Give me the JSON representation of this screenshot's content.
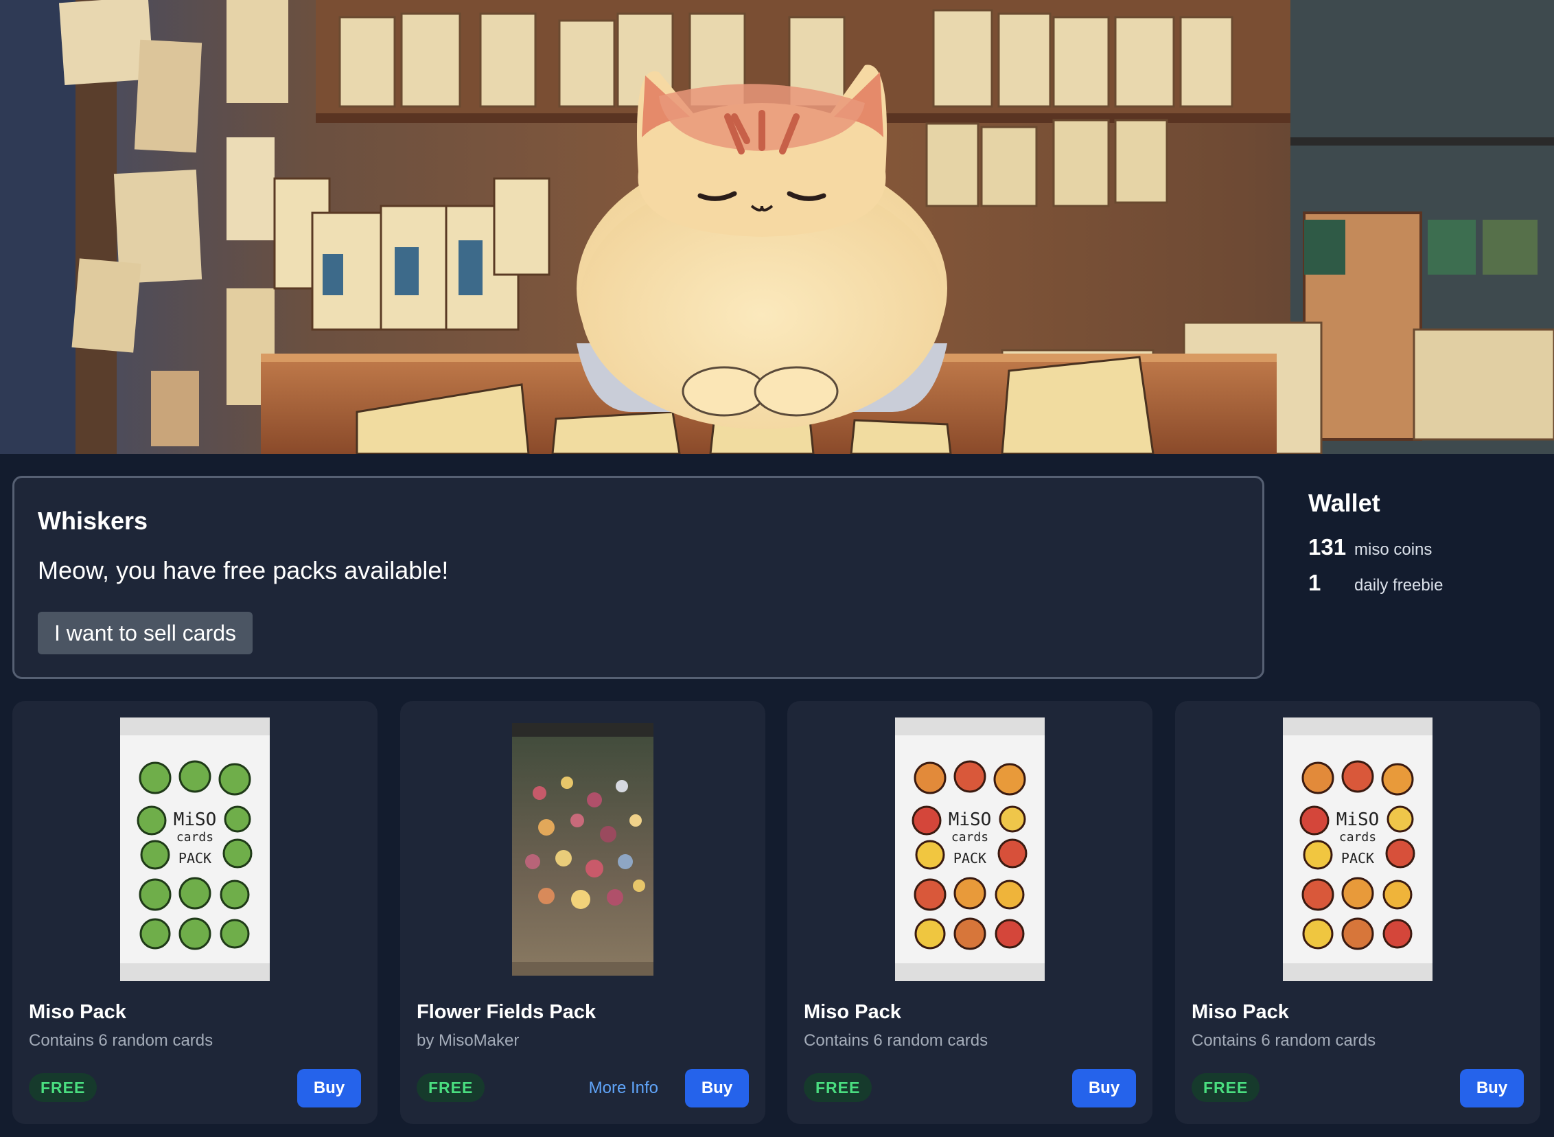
{
  "colors": {
    "page_background": "#131c2e",
    "panel_background": "#1e2638",
    "panel_border": "#566073",
    "secondary_button": "#4b5563",
    "primary_button": "#2563eb",
    "link": "#60a5fa",
    "free_badge_background": "#163a2c",
    "free_badge_text": "#4ade80",
    "muted_text": "#a4acb9"
  },
  "hero": {
    "image": "illustration of a cream and orange cat shopkeeper sitting behind a counter in a Japanese card shop"
  },
  "dialog": {
    "speaker": "Whiskers",
    "message": "Meow, you have free packs available!",
    "sell_button_label": "I want to sell cards"
  },
  "wallet": {
    "title": "Wallet",
    "rows": [
      {
        "value": "131",
        "label": "miso coins"
      },
      {
        "value": "1",
        "label": "daily freebie"
      }
    ]
  },
  "packs": [
    {
      "title": "Miso Pack",
      "subtitle": "Contains 6 random cards",
      "price": "FREE",
      "buy_label": "Buy",
      "image_icon": "green-miso-pack-icon",
      "art_text": [
        "MiSO",
        "cards",
        "PACK"
      ]
    },
    {
      "title": "Flower Fields Pack",
      "subtitle": "by MisoMaker",
      "price": "FREE",
      "more_info_label": "More Info",
      "buy_label": "Buy",
      "image_icon": "flower-field-pack-icon"
    },
    {
      "title": "Miso Pack",
      "subtitle": "Contains 6 random cards",
      "price": "FREE",
      "buy_label": "Buy",
      "image_icon": "orange-miso-pack-icon",
      "art_text": [
        "MiSO",
        "cards",
        "PACK"
      ]
    },
    {
      "title": "Miso Pack",
      "subtitle": "Contains 6 random cards",
      "price": "FREE",
      "buy_label": "Buy",
      "image_icon": "orange-miso-pack-icon",
      "art_text": [
        "MiSO",
        "cards",
        "PACK"
      ]
    }
  ]
}
